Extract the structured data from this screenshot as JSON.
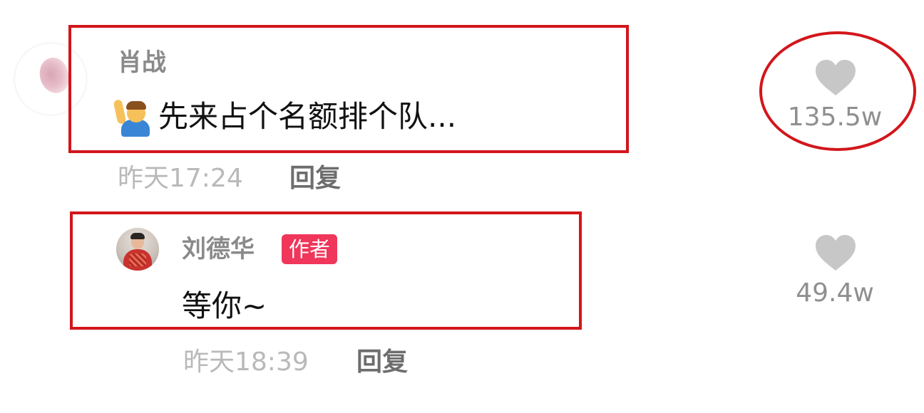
{
  "comment": {
    "username": "肖战",
    "text": "先来占个名额排个队...",
    "emoji": "person-raising-hand",
    "timestamp": "昨天17:24",
    "reply_label": "回复",
    "like_count": "135.5w"
  },
  "reply": {
    "username": "刘德华",
    "badge": "作者",
    "text": "等你~",
    "timestamp": "昨天18:39",
    "reply_label": "回复",
    "like_count": "49.4w"
  },
  "colors": {
    "annotation": "#d2161b",
    "author_badge": "#f0365a",
    "heart": "#c7c7c7"
  }
}
